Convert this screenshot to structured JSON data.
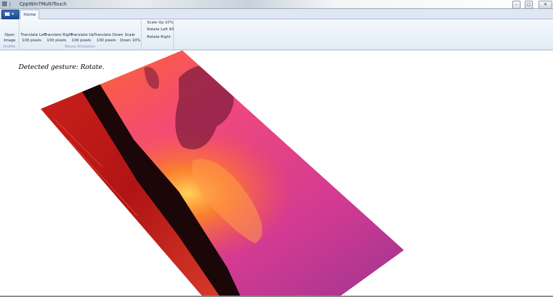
{
  "window": {
    "title": "CppWin7MultiTouch",
    "controls": {
      "minimize": "–",
      "maximize": "□",
      "close": "✕"
    }
  },
  "tabs": [
    {
      "label": "Home",
      "active": true
    }
  ],
  "ribbon": {
    "groups": [
      {
        "label": "Undfile",
        "buttons": [
          {
            "label_line1": "Open",
            "label_line2": "Image"
          }
        ]
      },
      {
        "label": "Mouse Simulation",
        "buttons": [
          {
            "label_line1": "Translate Left",
            "label_line2": "100 pixels"
          },
          {
            "label_line1": "Translate Right",
            "label_line2": "100 pixels"
          },
          {
            "label_line1": "Translate Up",
            "label_line2": "100 pixels"
          },
          {
            "label_line1": "Translate Down",
            "label_line2": "100 pixels"
          },
          {
            "label_line1": "Scale",
            "label_line2": "Down 10%"
          }
        ]
      },
      {
        "label": "",
        "buttons": [
          {
            "label": "Scale Up 10%"
          },
          {
            "label": "Rotate Left 90"
          },
          {
            "label": "Rotate Right"
          }
        ]
      }
    ]
  },
  "content": {
    "status_text": "Detected gesture: Rotate."
  },
  "icons": {
    "app": "app-icon",
    "menu": "application-menu-icon"
  },
  "colors": {
    "ribbon_bg": "#e2ebf5",
    "app_button": "#1d4c92",
    "sky_pink": "#e14c8a",
    "sun": "#ffb000"
  }
}
